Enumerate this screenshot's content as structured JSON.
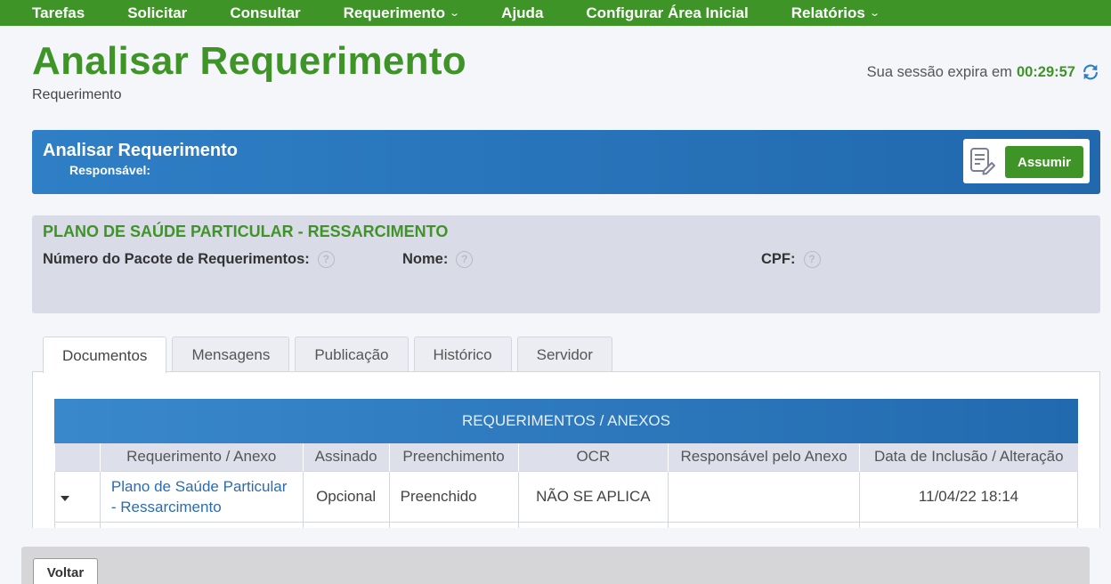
{
  "nav": {
    "items": [
      {
        "label": "Tarefas",
        "dropdown": false
      },
      {
        "label": "Solicitar",
        "dropdown": false
      },
      {
        "label": "Consultar",
        "dropdown": false
      },
      {
        "label": "Requerimento",
        "dropdown": true
      },
      {
        "label": "Ajuda",
        "dropdown": false
      },
      {
        "label": "Configurar Área Inicial",
        "dropdown": false
      },
      {
        "label": "Relatórios",
        "dropdown": true
      }
    ]
  },
  "header": {
    "title": "Analisar Requerimento",
    "subtitle": "Requerimento",
    "session_label": "Sua sessão expira em",
    "session_time": "00:29:57"
  },
  "panel": {
    "title": "Analisar Requerimento",
    "responsavel_label": "Responsável:",
    "assumir_label": "Assumir"
  },
  "info": {
    "title": "PLANO DE SAÚDE PARTICULAR - RESSARCIMENTO",
    "pacote_label": "Número do Pacote de Requerimentos:",
    "nome_label": "Nome:",
    "cpf_label": "CPF:",
    "help_glyph": "?"
  },
  "tabs": [
    {
      "label": "Documentos",
      "active": true
    },
    {
      "label": "Mensagens",
      "active": false
    },
    {
      "label": "Publicação",
      "active": false
    },
    {
      "label": "Histórico",
      "active": false
    },
    {
      "label": "Servidor",
      "active": false
    }
  ],
  "table": {
    "title": "REQUERIMENTOS / ANEXOS",
    "columns": [
      "",
      "Requerimento / Anexo",
      "Assinado",
      "Preenchimento",
      "OCR",
      "Responsável pelo Anexo",
      "Data de Inclusão / Alteração"
    ],
    "rows": [
      {
        "requerimento": "Plano de Saúde Particular - Ressarcimento",
        "assinado": "Opcional",
        "preenchimento": "Preenchido",
        "ocr": "NÃO SE APLICA",
        "responsavel": "",
        "data": "11/04/22 18:14"
      }
    ]
  },
  "footer": {
    "voltar_label": "Voltar"
  },
  "colors": {
    "brand_green": "#3f9428",
    "panel_blue": "#2f7fc6",
    "info_grey": "#d9dbe6"
  }
}
